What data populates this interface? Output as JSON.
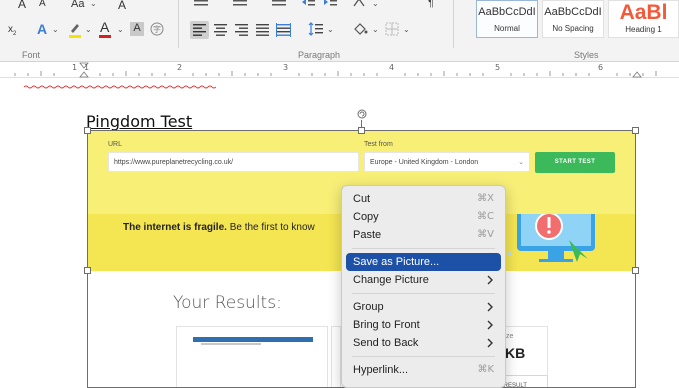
{
  "ribbon": {
    "font_group": {
      "font_grow_label": "A",
      "font_shrink_label": "A",
      "change_case_label": "Aa",
      "subscript_label": "x",
      "subscript_mark": "2",
      "text_effects_label": "A",
      "font_color_label": "A",
      "clear_format_label": "A",
      "group_label": "Font",
      "highlight_color": "#f5e400",
      "font_color": "#d81e1e"
    },
    "paragraph_group": {
      "group_label": "Paragraph"
    },
    "styles_group": {
      "group_label": "Styles",
      "styles": [
        {
          "preview": "AaBbCcDdI",
          "name": "Normal"
        },
        {
          "preview": "AaBbCcDdI",
          "name": "No Spacing"
        },
        {
          "preview": "AaBl",
          "name": "Heading 1"
        }
      ]
    }
  },
  "ruler": {
    "numbers": [
      "1",
      "1",
      "2",
      "3",
      "4",
      "5",
      "6"
    ]
  },
  "document": {
    "title": "Pingdom Test",
    "image": {
      "url_label": "URL",
      "url_value": "https://www.pureplanetrecycling.co.uk/",
      "test_from_label": "Test from",
      "test_from_value": "Europe - United Kingdom - London",
      "start_button": "START TEST",
      "fragile_bold": "The internet is fragile.",
      "fragile_rest": " Be the first to know",
      "results_title": "Your Results:",
      "share_button": "E RESULT",
      "size_label": "ze",
      "size_value": "KB"
    }
  },
  "context_menu": {
    "items": [
      {
        "label": "Cut",
        "shortcut": "⌘X"
      },
      {
        "label": "Copy",
        "shortcut": "⌘C"
      },
      {
        "label": "Paste",
        "shortcut": "⌘V"
      },
      {
        "label": "Save as Picture...",
        "shortcut": ""
      },
      {
        "label": "Change Picture",
        "shortcut": ""
      },
      {
        "label": "Group",
        "shortcut": ""
      },
      {
        "label": "Bring to Front",
        "shortcut": ""
      },
      {
        "label": "Send to Back",
        "shortcut": ""
      },
      {
        "label": "Hyperlink...",
        "shortcut": "⌘K"
      }
    ]
  },
  "colors": {
    "menu_highlight": "#1d51a8",
    "start_button": "#3cb95b",
    "banner_yellow": "#f7ef76"
  }
}
